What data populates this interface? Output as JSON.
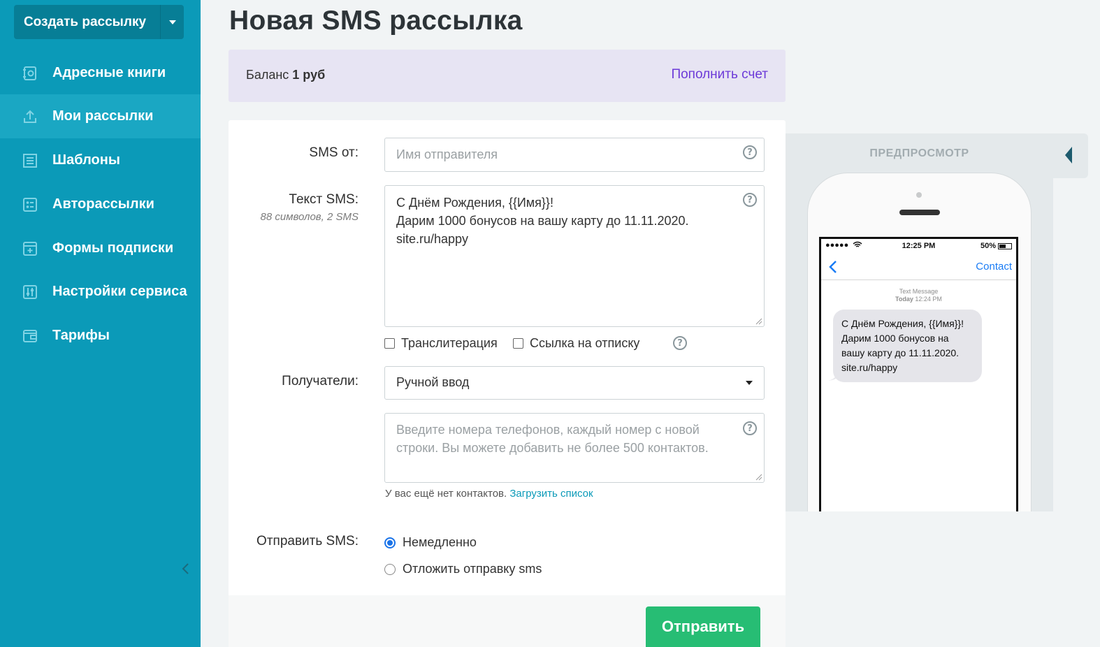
{
  "sidebar": {
    "create_button": "Создать рассылку",
    "items": [
      {
        "label": "Адресные книги",
        "icon": "address-book-icon",
        "active": false
      },
      {
        "label": "Мои рассылки",
        "icon": "upload-icon",
        "active": true
      },
      {
        "label": "Шаблоны",
        "icon": "template-icon",
        "active": false
      },
      {
        "label": "Авторассылки",
        "icon": "automation-icon",
        "active": false
      },
      {
        "label": "Формы подписки",
        "icon": "form-icon",
        "active": false
      },
      {
        "label": "Настройки сервиса",
        "icon": "settings-icon",
        "active": false
      },
      {
        "label": "Тарифы",
        "icon": "wallet-icon",
        "active": false
      }
    ]
  },
  "page": {
    "title": "Новая SMS рассылка"
  },
  "balance": {
    "label": "Баланс",
    "amount": "1 руб",
    "topup_link": "Пополнить счет"
  },
  "form": {
    "sender": {
      "label": "SMS от:",
      "placeholder": "Имя отправителя"
    },
    "text": {
      "label": "Текст SMS:",
      "counter": "88 символов, 2 SMS",
      "value": "С Днём Рождения, {{Имя}}!\nДарим 1000 бонусов на вашу карту до 11.11.2020.\nsite.ru/happy"
    },
    "options": {
      "transliteration": "Транслитерация",
      "unsubscribe_link": "Ссылка на отписку"
    },
    "recipients": {
      "label": "Получатели:",
      "selected": "Ручной ввод",
      "phones_placeholder": "Введите номера телефонов, каждый номер с новой строки. Вы можете добавить не более 500 контактов.",
      "no_contacts_text": "У вас ещё нет контактов.",
      "upload_link": "Загрузить список"
    },
    "send_time": {
      "label": "Отправить SMS:",
      "now": "Немедленно",
      "delay": "Отложить отправку sms",
      "selected": "now"
    },
    "submit": "Отправить"
  },
  "preview": {
    "title": "ПРЕДПРОСМОТР",
    "status_time": "12:25 PM",
    "battery": "50%",
    "contact": "Contact",
    "meta_line1": "Text Message",
    "meta_day": "Today",
    "meta_time": "12:24 PM",
    "message": "С Днём Рождения, {{Имя}}!\nДарим 1000 бонусов на вашу карту до 11.11.2020.\nsite.ru/happy"
  },
  "colors": {
    "sidebar_bg": "#0b9ab8",
    "sidebar_active": "#1aa7c3",
    "accent_link": "#6c3ad8",
    "teal_link": "#0b9ab8",
    "send_button": "#27bd74",
    "ios_blue": "#1a7cf5"
  }
}
